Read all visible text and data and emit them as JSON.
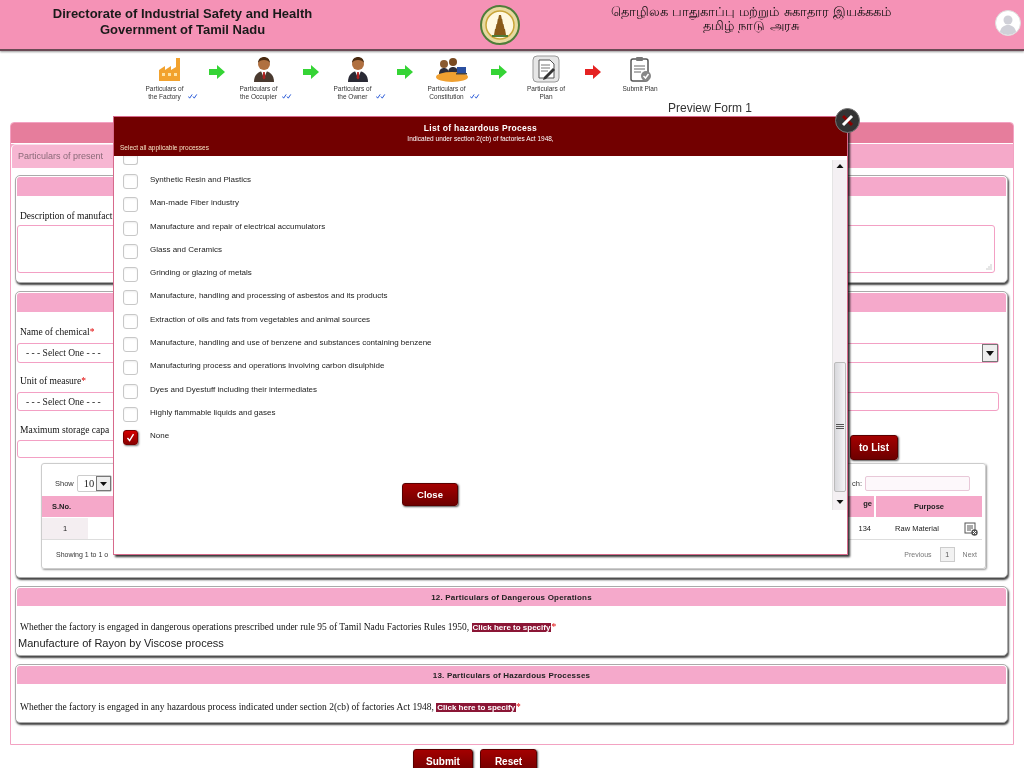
{
  "header": {
    "title_lines": [
      "Directorate of Industrial Safety and Health",
      "Government of Tamil Nadu"
    ],
    "tamil_lines": [
      "தொழிலக பாதுகாப்பு மற்றும் சுகாதார இயக்ககம்",
      "தமிழ் நாடு அரசு"
    ]
  },
  "steps": [
    {
      "label": "Particulars of the Factory",
      "completed": true
    },
    {
      "label": "Particulars of the Occupier",
      "completed": true
    },
    {
      "label": "Particulars of the Owner",
      "completed": true
    },
    {
      "label": "Particulars of Constitution",
      "completed": true
    },
    {
      "label": "Particulars of Plan",
      "completed": false
    },
    {
      "label": "Submit Plan",
      "completed": false
    }
  ],
  "preview_title": "Preview Form 1",
  "form": {
    "tab": "Particulars of present",
    "description_label": "Description of manufact",
    "fields": [
      {
        "label": "Name of chemical",
        "required_mark": "*",
        "value": "- - - Select One - - -",
        "dropdown_button": true
      },
      {
        "label": "Unit of measure",
        "required_mark": "*",
        "value": "- - - Select One - - -",
        "dropdown_button": false
      }
    ],
    "storage_label": "Maximum storage capa",
    "add_button": "to List",
    "table": {
      "length_label": "Show",
      "length_value": "10",
      "search_label": "ch:",
      "columns": [
        "S.No.",
        "ge",
        "Purpose"
      ],
      "rows": [
        {
          "s_no": "1",
          "column_2": "134",
          "purpose": "Raw Material"
        }
      ],
      "info": "Showing 1 to 1 o",
      "previous": "Previous",
      "pages": [
        {
          "label": "1",
          "selected": true
        }
      ],
      "next": "Next"
    }
  },
  "sections": [
    {
      "title": "12. Particulars of Dangerous Operations",
      "question": "Whether the factory is engaged in dangerous operations prescribed under rule 95 of Tamil Nadu Factories Rules 1950,",
      "link": "Click here to specify",
      "required_mark": "*",
      "answer": "Manufacture of Rayon by Viscose process"
    },
    {
      "title": "13. Particulars of Hazardous Processes",
      "question": "Whether the factory is engaged in any hazardous process indicated under section 2(cb) of factories Act 1948,",
      "link": "Click here to specify",
      "required_mark": "*"
    }
  ],
  "buttons": [
    "Submit",
    "Reset"
  ],
  "dialog": {
    "title": "List of hazardous Process",
    "subtitle": "Indicated under section 2(cb) of factories Act 1948,",
    "hint": "Select all applicable processes",
    "options": [
      {
        "kind": "partial",
        "checked": false
      },
      {
        "kind": "full",
        "label": "Synthetic Resin and Plastics",
        "checked": false
      },
      {
        "kind": "full",
        "label": "Man-made Fiber industry",
        "checked": false
      },
      {
        "kind": "full",
        "label": "Manufacture and repair of electrical accumulators",
        "checked": false
      },
      {
        "kind": "full",
        "label": "Glass and Ceramics",
        "checked": false
      },
      {
        "kind": "full",
        "label": "Grinding or glazing of metals",
        "checked": false
      },
      {
        "kind": "full",
        "label": "Manufacture, handling and processing of asbestos and its products",
        "checked": false
      },
      {
        "kind": "full",
        "label": "Extraction of oils and fats from vegetables and animal sources",
        "checked": false
      },
      {
        "kind": "full",
        "label": "Manufacture, handling and use of benzene and substances containing benzene",
        "checked": false
      },
      {
        "kind": "full",
        "label": "Manufacturing process and operations involving carbon disulphide",
        "checked": false
      },
      {
        "kind": "full",
        "label": "Dyes and Dyestuff including their intermediates",
        "checked": false
      },
      {
        "kind": "full",
        "label": "Highly flammable liquids and gases",
        "checked": false
      },
      {
        "kind": "full",
        "label": "None",
        "checked": true
      }
    ],
    "close_button": "Close"
  }
}
